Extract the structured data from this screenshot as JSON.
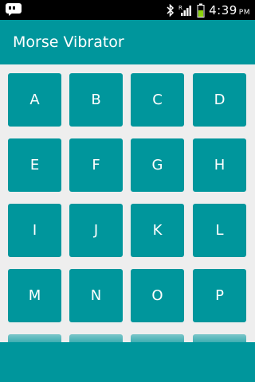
{
  "status_bar": {
    "time": "4:39",
    "ampm": "PM",
    "icons": [
      "talk-app-icon",
      "bluetooth-icon",
      "signal-icon",
      "battery-icon"
    ]
  },
  "app": {
    "title": "Morse Vibrator"
  },
  "keys": [
    "A",
    "B",
    "C",
    "D",
    "E",
    "F",
    "G",
    "H",
    "I",
    "J",
    "K",
    "L",
    "M",
    "N",
    "O",
    "P"
  ],
  "colors": {
    "primary": "#00969c",
    "background": "#eeeeee",
    "status_bar": "#000000",
    "text": "#ffffff"
  }
}
